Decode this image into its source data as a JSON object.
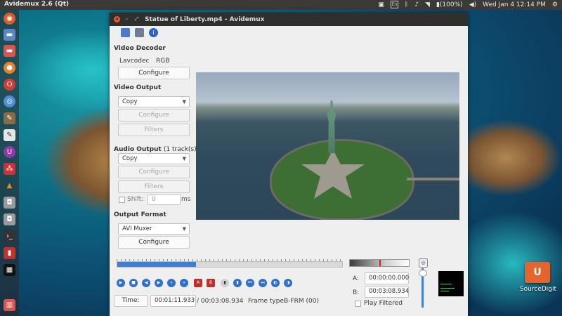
{
  "top_panel": {
    "app_name": "Avidemux 2.6 (Qt)",
    "battery": "(100%)",
    "clock": "Wed Jan  4 12:14 PM",
    "indicators": [
      "dropbox-icon",
      "keyboard-icon",
      "bluetooth-icon",
      "notification-icon",
      "wifi-icon",
      "battery-icon",
      "volume-icon",
      "power-gear-icon"
    ],
    "keyboard_label": "En"
  },
  "launcher": {
    "items": [
      "ubuntu-icon",
      "files-icon",
      "files-red-icon",
      "firefox-icon",
      "opera-icon",
      "chromium-icon",
      "gimp-icon",
      "text-editor-icon",
      "ubuntu-u-icon",
      "shutter-icon",
      "vlc-icon",
      "disk-icon",
      "disk-icon-2",
      "terminal-icon",
      "app-red-icon",
      "avidemux-icon",
      "trash-icon"
    ]
  },
  "window": {
    "title": "Statue of Liberty.mp4 - Avidemux",
    "video_decoder": {
      "header": "Video Decoder",
      "codec": "Lavcodec",
      "format": "RGB",
      "configure": "Configure"
    },
    "video_output": {
      "header": "Video Output",
      "selected": "Copy",
      "configure": "Configure",
      "filters": "Filters"
    },
    "audio_output": {
      "header": "Audio Output",
      "tracks": "(1 track(s))",
      "selected": "Copy",
      "configure": "Configure",
      "filters": "Filters",
      "shift_label": "Shift:",
      "shift_value": "0",
      "shift_unit": "ms"
    },
    "output_format": {
      "header": "Output Format",
      "selected": "AVI Muxer",
      "configure": "Configure"
    },
    "timeline": {
      "progress": 0.35
    },
    "status": {
      "time_button": "Time:",
      "current_time": "00:01:11.933",
      "total_time": "/ 00:03:08.934",
      "frame_type_label": "Frame type:",
      "frame_type_value": "B-FRM (00)"
    },
    "selection": {
      "a_label": "A:",
      "a_value": "00:00:00.000",
      "b_label": "B:",
      "b_value": "00:03:08.934",
      "play_filtered": "Play Filtered"
    }
  },
  "desktop": {
    "icon_label": "SourceDigit",
    "icon_glyph": "U"
  }
}
